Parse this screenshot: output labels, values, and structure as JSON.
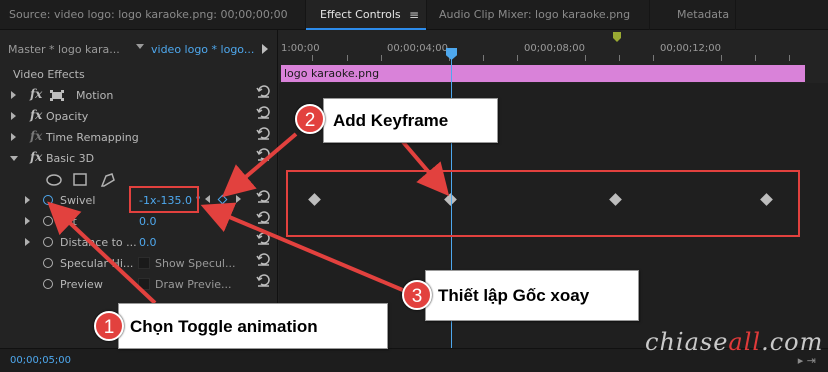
{
  "tabs": [
    {
      "label": "Source: video logo: logo karaoke.png: 00;00;00;00",
      "active": false
    },
    {
      "label": "Effect Controls",
      "active": true
    },
    {
      "label": "Audio Clip Mixer: logo karaoke.png",
      "active": false
    },
    {
      "label": "Metadata",
      "active": false
    }
  ],
  "tab_menu_icon": "≡",
  "header": {
    "master": "Master * logo kara...",
    "clip": "video logo * logo..."
  },
  "video_effects_label": "Video Effects",
  "effects": {
    "motion": "Motion",
    "opacity": "Opacity",
    "time_remapping": "Time Remapping",
    "basic3d": "Basic 3D"
  },
  "params": {
    "swivel": {
      "label": "Swivel",
      "value": "-1x-135.0 °"
    },
    "tilt": {
      "label": "Tilt",
      "value": "0.0"
    },
    "distance": {
      "label": "Distance to ...",
      "value": "0.0"
    },
    "specular": {
      "label": "Specular Hi...",
      "checkbox_label": "Show Specul..."
    },
    "preview": {
      "label": "Preview",
      "checkbox_label": "Draw Previe..."
    }
  },
  "ruler": {
    "labels": [
      "1:00;00",
      "00;00;04;00",
      "00;00;08;00",
      "00;00;12;00"
    ]
  },
  "clip_label": "logo karaoke.png",
  "timecode": "00;00;05;00",
  "watermark": {
    "part1": "chiase",
    "part2": "all",
    "part3": ".com"
  },
  "annotations": {
    "a1": {
      "num": "1",
      "text": "Chọn Toggle animation"
    },
    "a2": {
      "num": "2",
      "text": "Add Keyframe"
    },
    "a3": {
      "num": "3",
      "text": "Thiết lập Gốc xoay"
    }
  },
  "colors": {
    "accent": "#4ea8ee",
    "clip": "#d982d9",
    "annotation_red": "#e2413e"
  }
}
